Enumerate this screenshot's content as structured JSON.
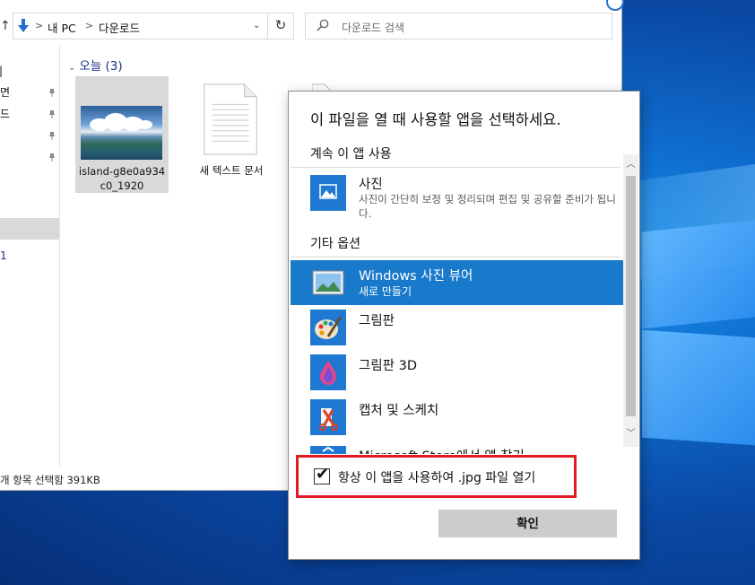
{
  "explorer": {
    "address": {
      "segments": [
        "내 PC",
        "다운로드"
      ]
    },
    "search": {
      "placeholder": "다운로드 검색"
    },
    "sidebar": {
      "items": [
        "|",
        "면",
        "드",
        "",
        "",
        "1"
      ]
    },
    "group": {
      "label": "오늘 (3)"
    },
    "files": [
      {
        "name_line1": "island-g8e0a934",
        "name_line2": "c0_1920",
        "selected": true,
        "icon": "image-thumbnail"
      },
      {
        "name_line1": "새 텍스트 문서",
        "name_line2": "",
        "selected": false,
        "icon": "text-document-icon"
      }
    ],
    "status": "개 항목 선택함 391KB"
  },
  "dialog": {
    "title": "이 파일을 열 때 사용할 앱을 선택하세요.",
    "continue_section": "계속 이 앱 사용",
    "current_app": {
      "name": "사진",
      "description": "사진이 간단히 보정 및 정리되며 편집 및 공유할 준비가 됩니다.",
      "icon": "photos-icon"
    },
    "other_section": "기타 옵션",
    "apps": [
      {
        "name": "Windows 사진 뷰어",
        "sub": "새로 만들기",
        "active": true,
        "icon": "photo-viewer-icon"
      },
      {
        "name": "그림판",
        "icon": "paint-icon"
      },
      {
        "name": "그림판 3D",
        "icon": "paint3d-icon"
      },
      {
        "name": "캡처 및 스케치",
        "icon": "snip-sketch-icon"
      },
      {
        "name": "Microsoft Store에서 앱 찾기",
        "icon": "store-icon"
      }
    ],
    "always_use": {
      "label": "항상 이 앱을 사용하여 .jpg 파일 열기",
      "checked": true
    },
    "ok_label": "확인",
    "colors": {
      "accent": "#1979ca",
      "highlight_border": "#e01b23",
      "ok_bg": "#cccccc"
    }
  }
}
